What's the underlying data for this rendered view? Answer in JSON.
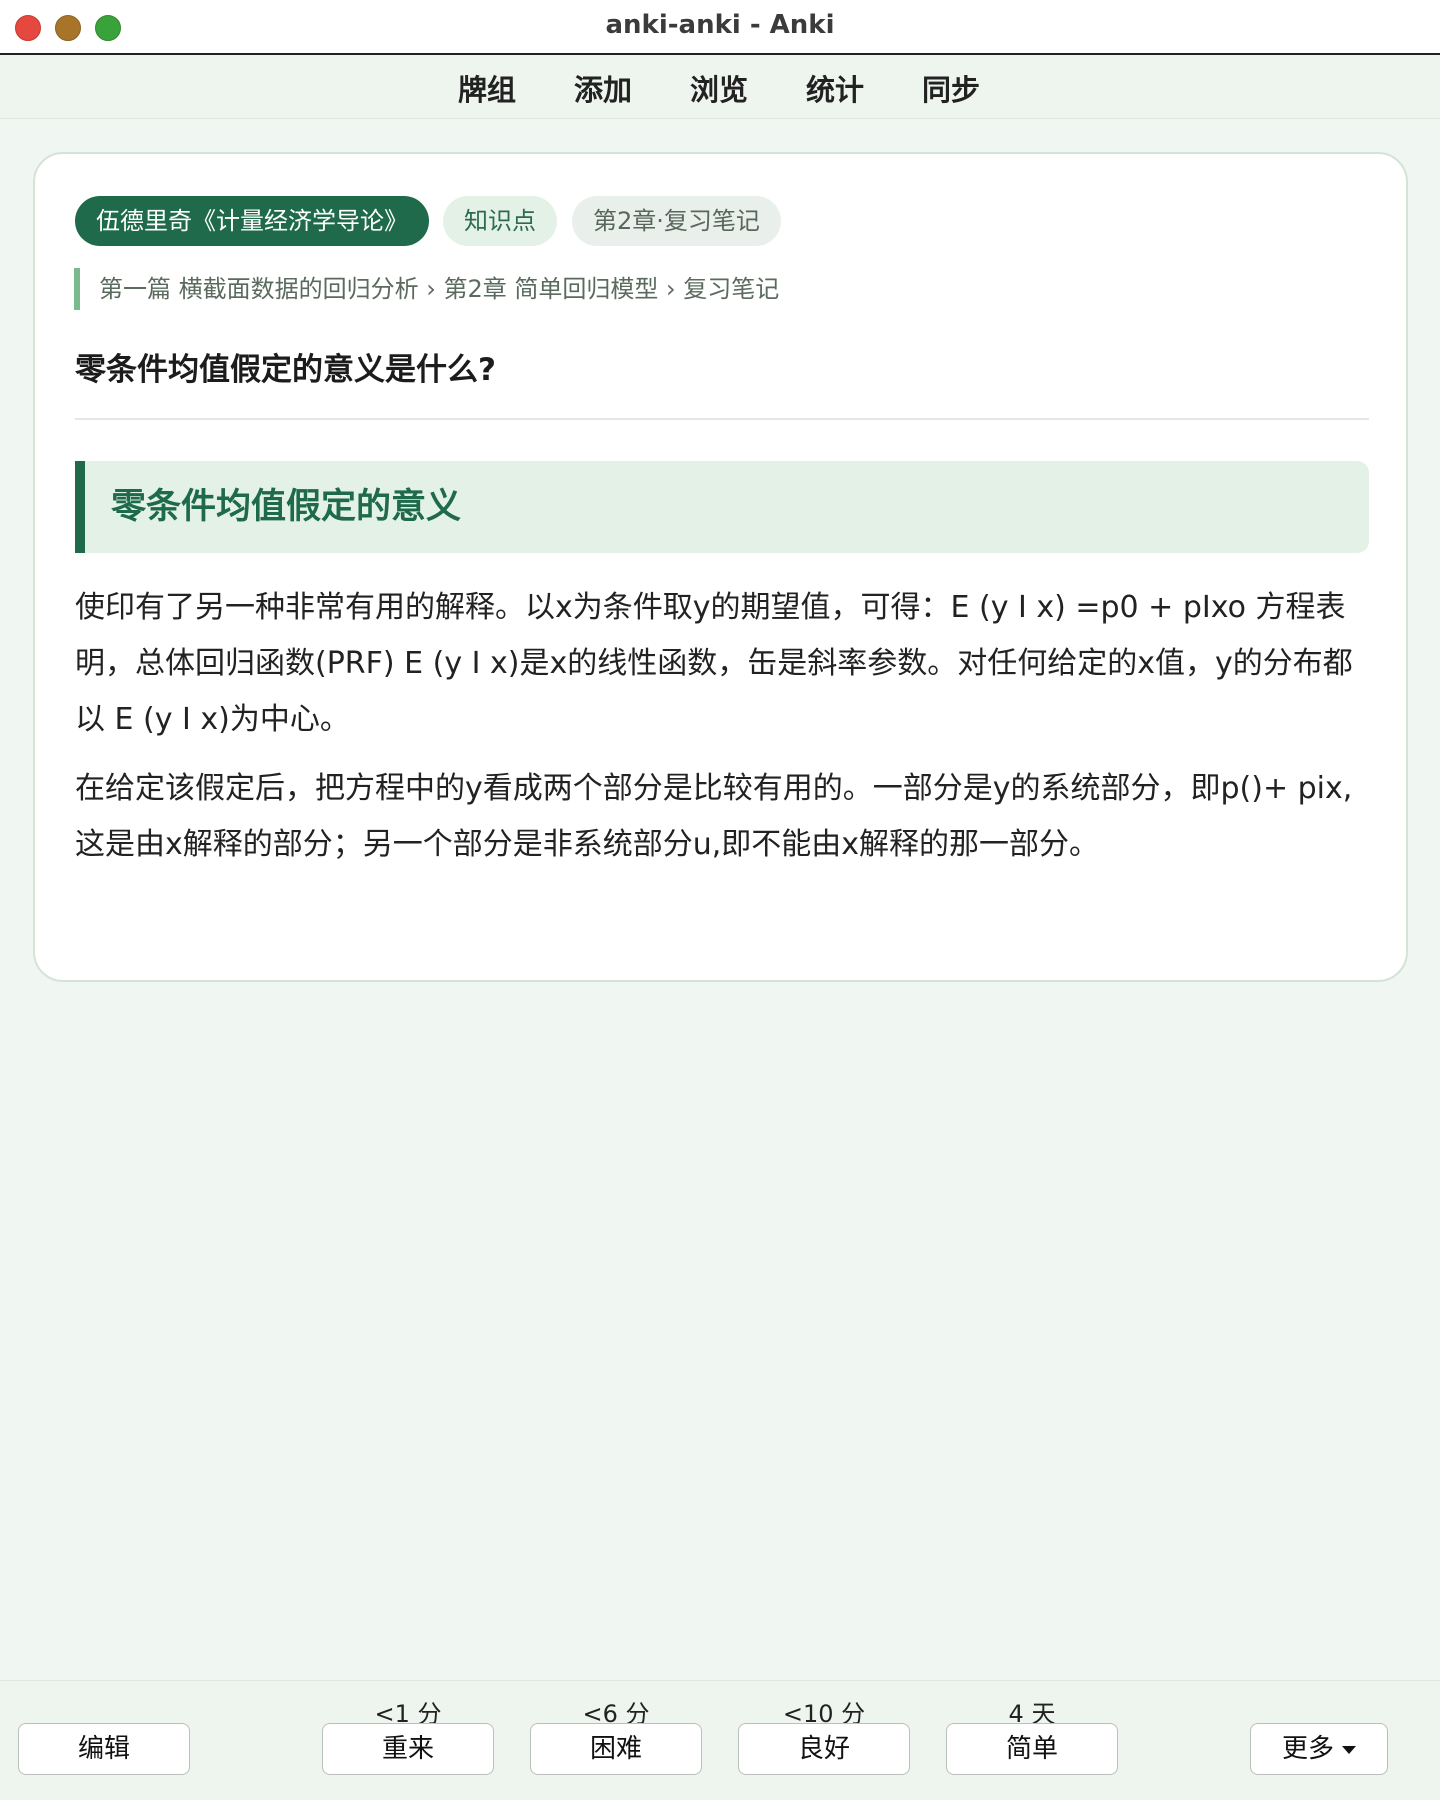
{
  "window": {
    "title": "anki-anki - Anki"
  },
  "toolbar": {
    "items": [
      {
        "label": "牌组"
      },
      {
        "label": "添加"
      },
      {
        "label": "浏览"
      },
      {
        "label": "统计"
      },
      {
        "label": "同步"
      }
    ]
  },
  "card": {
    "tags": [
      "伍德里奇《计量经济学导论》",
      "知识点",
      "第2章·复习笔记"
    ],
    "breadcrumb": "第一篇 横截面数据的回归分析 › 第2章 简单回归模型 › 复习笔记",
    "question": "零条件均值假定的意义是什么?",
    "section_title": "零条件均值假定的意义",
    "paragraphs": [
      "使印有了另一种非常有用的解释。以x为条件取y的期望值，可得：E (y I x) =p0 + pIxo 方程表 明，总体回归函数(PRF) E (y I x)是x的线性函数，缶是斜率参数。对任何给定的x值，y的分布都以 E (y I x)为中心。",
      "在给定该假定后，把方程中的y看成两个部分是比较有用的。一部分是y的系统部分，即p()+ pix, 这是由x解释的部分；另一个部分是非系统部分u,即不能由x解释的那一部分。"
    ]
  },
  "bottom": {
    "edit_label": "编辑",
    "answers": [
      {
        "interval": "<1 分",
        "label": "重来"
      },
      {
        "interval": "<6 分",
        "label": "困难"
      },
      {
        "interval": "<10 分",
        "label": "良好"
      },
      {
        "interval": "4 天",
        "label": "简单"
      }
    ],
    "more_label": "更多"
  },
  "colors": {
    "accent": "#1e6a4b",
    "accent_light": "#e4f1e6",
    "background": "#f0f6f1",
    "close": "#e5483f",
    "minimize": "#a8742a",
    "maximize": "#3aa23a"
  }
}
